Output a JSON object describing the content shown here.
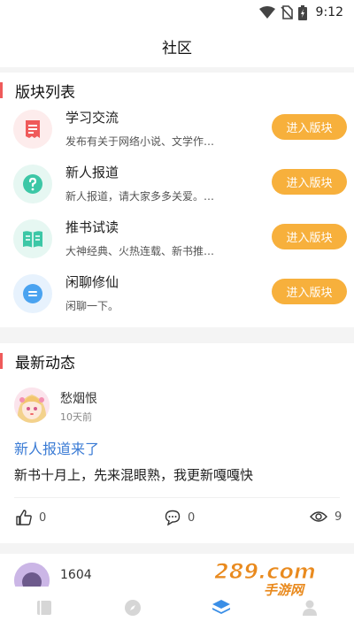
{
  "status_bar": {
    "time": "9:12"
  },
  "header": {
    "title": "社区"
  },
  "forum_section": {
    "title": "版块列表",
    "items": [
      {
        "name": "学习交流",
        "desc": "发布有关于网络小说、文学作…",
        "button": "进入版块",
        "icon": "document-icon",
        "color": "#ef5a5a",
        "bg": "#fdecec"
      },
      {
        "name": "新人报道",
        "desc": "新人报道，请大家多多关爱。…",
        "button": "进入版块",
        "icon": "question-icon",
        "color": "#3cc7a6",
        "bg": "#e6f7f2"
      },
      {
        "name": "推书试读",
        "desc": "大神经典、火热连载、新书推…",
        "button": "进入版块",
        "icon": "book-icon",
        "color": "#3cc7a6",
        "bg": "#e6f7f2"
      },
      {
        "name": "闲聊修仙",
        "desc": "闲聊一下。",
        "button": "进入版块",
        "icon": "chat-icon",
        "color": "#4aa3f0",
        "bg": "#e7f2fd"
      }
    ]
  },
  "latest_section": {
    "title": "最新动态",
    "post": {
      "author": "愁烟恨",
      "time": "10天前",
      "title": "新人报道来了",
      "body": "新书十月上，先来混眼熟，我更新嘎嘎快",
      "likes": "0",
      "comments": "0",
      "views": "9"
    },
    "next_post": {
      "author": "1604"
    }
  },
  "tabs": [
    {
      "icon": "bookshelf-icon",
      "active": false
    },
    {
      "icon": "compass-icon",
      "active": false
    },
    {
      "icon": "layers-icon",
      "active": true
    },
    {
      "icon": "profile-icon",
      "active": false
    }
  ],
  "watermark": {
    "text": "手游网",
    "logo": "289.com"
  },
  "colors": {
    "accent": "#ef5a5a",
    "button": "#f7b03c",
    "link": "#3a7bd5",
    "tab_active": "#3a8ee6",
    "tab_inactive": "#d6d6d6"
  }
}
